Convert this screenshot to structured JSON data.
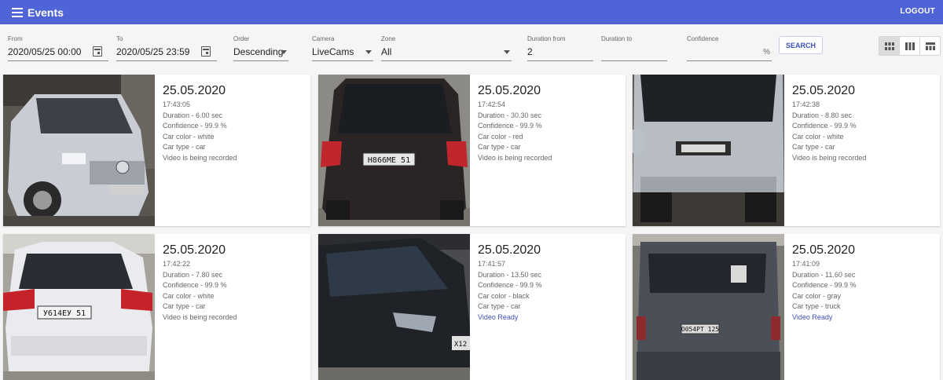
{
  "app": {
    "title": "Events",
    "logout": "LOGOUT"
  },
  "filters": {
    "from": {
      "label": "From",
      "value": "2020/05/25 00:00"
    },
    "to": {
      "label": "To",
      "value": "2020/05/25 23:59"
    },
    "order": {
      "label": "Order",
      "value": "Descending"
    },
    "camera": {
      "label": "Camera",
      "value": "LiveCams"
    },
    "zone": {
      "label": "Zone",
      "value": "All"
    },
    "duration_from": {
      "label": "Duration from",
      "value": "2"
    },
    "duration_to": {
      "label": "Duration to",
      "value": ""
    },
    "confidence": {
      "label": "Confidence",
      "value": "",
      "unit": "%"
    },
    "search_label": "SEARCH"
  },
  "view_modes": [
    "grid-small-icon",
    "grid-columns-icon",
    "grid-table-icon"
  ],
  "colors": {
    "appbar": "#4f64d6",
    "accent": "#3f51b5"
  },
  "events": [
    {
      "date": "25.05.2020",
      "time": "17:43:05",
      "duration": "Duration - 6.00 sec",
      "confidence": "Confidence - 99.9 %",
      "color": "Car color - white",
      "type": "Car type - car",
      "status": "Video is being recorded",
      "ready": false,
      "plate": ""
    },
    {
      "date": "25.05.2020",
      "time": "17:42:54",
      "duration": "Duration - 30.30 sec",
      "confidence": "Confidence - 99.9 %",
      "color": "Car color - red",
      "type": "Car type - car",
      "status": "Video is being recorded",
      "ready": false,
      "plate": "Н866МЕ 51"
    },
    {
      "date": "25.05.2020",
      "time": "17:42:38",
      "duration": "Duration - 8.80 sec",
      "confidence": "Confidence - 99.9 %",
      "color": "Car color - white",
      "type": "Car type - car",
      "status": "Video is being recorded",
      "ready": false,
      "plate": ""
    },
    {
      "date": "25.05.2020",
      "time": "17:42:22",
      "duration": "Duration - 7.80 sec",
      "confidence": "Confidence - 99.9 %",
      "color": "Car color - white",
      "type": "Car type - car",
      "status": "Video is being recorded",
      "ready": false,
      "plate": "У614ЕУ 51"
    },
    {
      "date": "25.05.2020",
      "time": "17:41:57",
      "duration": "Duration - 13.50 sec",
      "confidence": "Confidence - 99.9 %",
      "color": "Car color - black",
      "type": "Car type - car",
      "status": "Video Ready",
      "ready": true,
      "plate": "Х12"
    },
    {
      "date": "25.05.2020",
      "time": "17:41:09",
      "duration": "Duration - 11.60 sec",
      "confidence": "Confidence - 99.9 %",
      "color": "Car color - gray",
      "type": "Car type - truck",
      "status": "Video Ready",
      "ready": true,
      "plate": "О054РТ 125"
    }
  ]
}
